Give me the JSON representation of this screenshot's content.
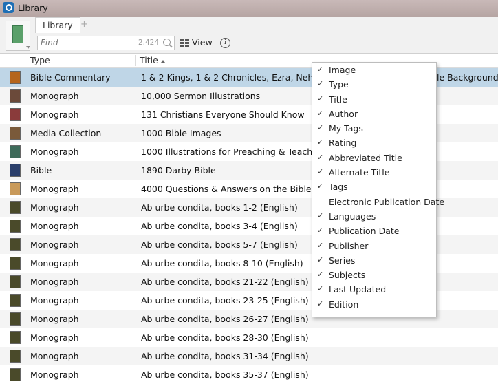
{
  "window": {
    "title": "Library"
  },
  "toolbar": {
    "tab_label": "Library",
    "add_tab": "+",
    "find_placeholder": "Find",
    "find_count": "2,424",
    "view_label": "View",
    "info_label": "i"
  },
  "columns": {
    "type": "Type",
    "title": "Title"
  },
  "rows": [
    {
      "type": "Bible Commentary",
      "title": "1 & 2 Kings, 1 & 2 Chronicles, Ezra, Nehemiah,",
      "selected": true,
      "overflow": "le Backgrounds C",
      "thumb": "#b5651d"
    },
    {
      "type": "Monograph",
      "title": "10,000 Sermon Illustrations",
      "thumb": "#6b4a3a"
    },
    {
      "type": "Monograph",
      "title": "131 Christians Everyone Should Know",
      "thumb": "#8a3b3b"
    },
    {
      "type": "Media Collection",
      "title": "1000 Bible Images",
      "thumb": "#7a5a3a"
    },
    {
      "type": "Monograph",
      "title": "1000 Illustrations for Preaching & Teaching",
      "thumb": "#3e6b5a"
    },
    {
      "type": "Bible",
      "title": "1890 Darby Bible",
      "thumb": "#2b3f6b"
    },
    {
      "type": "Monograph",
      "title": "4000 Questions & Answers on the Bible",
      "thumb": "#c99a5a"
    },
    {
      "type": "Monograph",
      "title": "Ab urbe condita, books 1-2 (English)",
      "thumb": "#4a4a2a"
    },
    {
      "type": "Monograph",
      "title": "Ab urbe condita, books 3-4 (English)",
      "thumb": "#4a4a2a"
    },
    {
      "type": "Monograph",
      "title": "Ab urbe condita, books 5-7 (English)",
      "thumb": "#4a4a2a"
    },
    {
      "type": "Monograph",
      "title": "Ab urbe condita, books 8-10 (English)",
      "thumb": "#4a4a2a"
    },
    {
      "type": "Monograph",
      "title": "Ab urbe condita, books 21-22 (English)",
      "thumb": "#4a4a2a"
    },
    {
      "type": "Monograph",
      "title": "Ab urbe condita, books 23-25 (English)",
      "thumb": "#4a4a2a"
    },
    {
      "type": "Monograph",
      "title": "Ab urbe condita, books 26-27 (English)",
      "thumb": "#4a4a2a"
    },
    {
      "type": "Monograph",
      "title": "Ab urbe condita, books 28-30 (English)",
      "thumb": "#4a4a2a"
    },
    {
      "type": "Monograph",
      "title": "Ab urbe condita, books 31-34 (English)",
      "thumb": "#4a4a2a"
    },
    {
      "type": "Monograph",
      "title": "Ab urbe condita, books 35-37 (English)",
      "thumb": "#4a4a2a"
    }
  ],
  "column_menu": [
    {
      "label": "Image",
      "checked": true
    },
    {
      "label": "Type",
      "checked": true
    },
    {
      "label": "Title",
      "checked": true
    },
    {
      "label": "Author",
      "checked": true
    },
    {
      "label": "My Tags",
      "checked": true
    },
    {
      "label": "Rating",
      "checked": true
    },
    {
      "label": "Abbreviated Title",
      "checked": true
    },
    {
      "label": "Alternate Title",
      "checked": true
    },
    {
      "label": "Tags",
      "checked": true
    },
    {
      "label": "Electronic Publication Date",
      "checked": false
    },
    {
      "label": "Languages",
      "checked": true
    },
    {
      "label": "Publication Date",
      "checked": true
    },
    {
      "label": "Publisher",
      "checked": true
    },
    {
      "label": "Series",
      "checked": true
    },
    {
      "label": "Subjects",
      "checked": true
    },
    {
      "label": "Last Updated",
      "checked": true
    },
    {
      "label": "Edition",
      "checked": true
    }
  ],
  "check_mark": "✓",
  "colors": {
    "selected_row": "#bfd6e7",
    "alt_row": "#f4f4f4",
    "title_bar": "#b6a5a3"
  }
}
